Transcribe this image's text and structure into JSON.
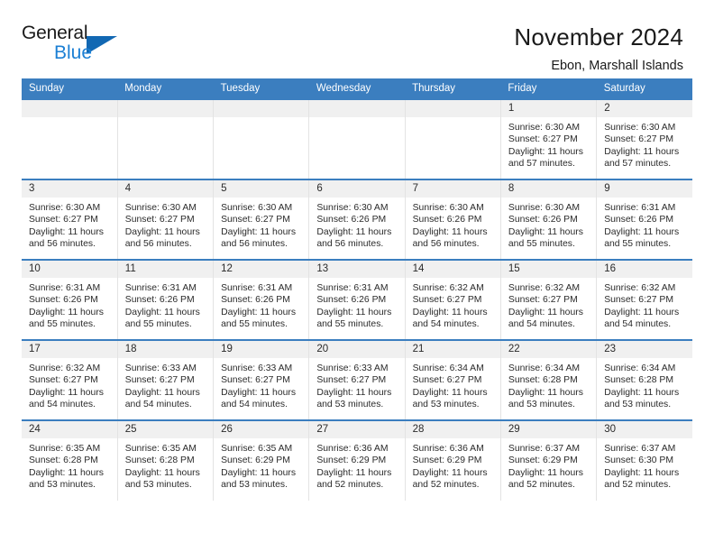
{
  "logo": {
    "word1": "General",
    "word2": "Blue",
    "triangle": "blue-triangle",
    "accent_color": "#1268b3",
    "blue_text_color": "#1b7fd4"
  },
  "header": {
    "title": "November 2024",
    "subtitle": "Ebon, Marshall Islands"
  },
  "calendar": {
    "header_bg": "#3b7ebf",
    "daynum_bg": "#f0f0f0",
    "weekdays": [
      "Sunday",
      "Monday",
      "Tuesday",
      "Wednesday",
      "Thursday",
      "Friday",
      "Saturday"
    ],
    "weeks": [
      [
        {
          "day": "",
          "empty": true
        },
        {
          "day": "",
          "empty": true
        },
        {
          "day": "",
          "empty": true
        },
        {
          "day": "",
          "empty": true
        },
        {
          "day": "",
          "empty": true
        },
        {
          "day": "1",
          "sunrise": "Sunrise: 6:30 AM",
          "sunset": "Sunset: 6:27 PM",
          "daylight": "Daylight: 11 hours and 57 minutes."
        },
        {
          "day": "2",
          "sunrise": "Sunrise: 6:30 AM",
          "sunset": "Sunset: 6:27 PM",
          "daylight": "Daylight: 11 hours and 57 minutes."
        }
      ],
      [
        {
          "day": "3",
          "sunrise": "Sunrise: 6:30 AM",
          "sunset": "Sunset: 6:27 PM",
          "daylight": "Daylight: 11 hours and 56 minutes."
        },
        {
          "day": "4",
          "sunrise": "Sunrise: 6:30 AM",
          "sunset": "Sunset: 6:27 PM",
          "daylight": "Daylight: 11 hours and 56 minutes."
        },
        {
          "day": "5",
          "sunrise": "Sunrise: 6:30 AM",
          "sunset": "Sunset: 6:27 PM",
          "daylight": "Daylight: 11 hours and 56 minutes."
        },
        {
          "day": "6",
          "sunrise": "Sunrise: 6:30 AM",
          "sunset": "Sunset: 6:26 PM",
          "daylight": "Daylight: 11 hours and 56 minutes."
        },
        {
          "day": "7",
          "sunrise": "Sunrise: 6:30 AM",
          "sunset": "Sunset: 6:26 PM",
          "daylight": "Daylight: 11 hours and 56 minutes."
        },
        {
          "day": "8",
          "sunrise": "Sunrise: 6:30 AM",
          "sunset": "Sunset: 6:26 PM",
          "daylight": "Daylight: 11 hours and 55 minutes."
        },
        {
          "day": "9",
          "sunrise": "Sunrise: 6:31 AM",
          "sunset": "Sunset: 6:26 PM",
          "daylight": "Daylight: 11 hours and 55 minutes."
        }
      ],
      [
        {
          "day": "10",
          "sunrise": "Sunrise: 6:31 AM",
          "sunset": "Sunset: 6:26 PM",
          "daylight": "Daylight: 11 hours and 55 minutes."
        },
        {
          "day": "11",
          "sunrise": "Sunrise: 6:31 AM",
          "sunset": "Sunset: 6:26 PM",
          "daylight": "Daylight: 11 hours and 55 minutes."
        },
        {
          "day": "12",
          "sunrise": "Sunrise: 6:31 AM",
          "sunset": "Sunset: 6:26 PM",
          "daylight": "Daylight: 11 hours and 55 minutes."
        },
        {
          "day": "13",
          "sunrise": "Sunrise: 6:31 AM",
          "sunset": "Sunset: 6:26 PM",
          "daylight": "Daylight: 11 hours and 55 minutes."
        },
        {
          "day": "14",
          "sunrise": "Sunrise: 6:32 AM",
          "sunset": "Sunset: 6:27 PM",
          "daylight": "Daylight: 11 hours and 54 minutes."
        },
        {
          "day": "15",
          "sunrise": "Sunrise: 6:32 AM",
          "sunset": "Sunset: 6:27 PM",
          "daylight": "Daylight: 11 hours and 54 minutes."
        },
        {
          "day": "16",
          "sunrise": "Sunrise: 6:32 AM",
          "sunset": "Sunset: 6:27 PM",
          "daylight": "Daylight: 11 hours and 54 minutes."
        }
      ],
      [
        {
          "day": "17",
          "sunrise": "Sunrise: 6:32 AM",
          "sunset": "Sunset: 6:27 PM",
          "daylight": "Daylight: 11 hours and 54 minutes."
        },
        {
          "day": "18",
          "sunrise": "Sunrise: 6:33 AM",
          "sunset": "Sunset: 6:27 PM",
          "daylight": "Daylight: 11 hours and 54 minutes."
        },
        {
          "day": "19",
          "sunrise": "Sunrise: 6:33 AM",
          "sunset": "Sunset: 6:27 PM",
          "daylight": "Daylight: 11 hours and 54 minutes."
        },
        {
          "day": "20",
          "sunrise": "Sunrise: 6:33 AM",
          "sunset": "Sunset: 6:27 PM",
          "daylight": "Daylight: 11 hours and 53 minutes."
        },
        {
          "day": "21",
          "sunrise": "Sunrise: 6:34 AM",
          "sunset": "Sunset: 6:27 PM",
          "daylight": "Daylight: 11 hours and 53 minutes."
        },
        {
          "day": "22",
          "sunrise": "Sunrise: 6:34 AM",
          "sunset": "Sunset: 6:28 PM",
          "daylight": "Daylight: 11 hours and 53 minutes."
        },
        {
          "day": "23",
          "sunrise": "Sunrise: 6:34 AM",
          "sunset": "Sunset: 6:28 PM",
          "daylight": "Daylight: 11 hours and 53 minutes."
        }
      ],
      [
        {
          "day": "24",
          "sunrise": "Sunrise: 6:35 AM",
          "sunset": "Sunset: 6:28 PM",
          "daylight": "Daylight: 11 hours and 53 minutes."
        },
        {
          "day": "25",
          "sunrise": "Sunrise: 6:35 AM",
          "sunset": "Sunset: 6:28 PM",
          "daylight": "Daylight: 11 hours and 53 minutes."
        },
        {
          "day": "26",
          "sunrise": "Sunrise: 6:35 AM",
          "sunset": "Sunset: 6:29 PM",
          "daylight": "Daylight: 11 hours and 53 minutes."
        },
        {
          "day": "27",
          "sunrise": "Sunrise: 6:36 AM",
          "sunset": "Sunset: 6:29 PM",
          "daylight": "Daylight: 11 hours and 52 minutes."
        },
        {
          "day": "28",
          "sunrise": "Sunrise: 6:36 AM",
          "sunset": "Sunset: 6:29 PM",
          "daylight": "Daylight: 11 hours and 52 minutes."
        },
        {
          "day": "29",
          "sunrise": "Sunrise: 6:37 AM",
          "sunset": "Sunset: 6:29 PM",
          "daylight": "Daylight: 11 hours and 52 minutes."
        },
        {
          "day": "30",
          "sunrise": "Sunrise: 6:37 AM",
          "sunset": "Sunset: 6:30 PM",
          "daylight": "Daylight: 11 hours and 52 minutes."
        }
      ]
    ]
  }
}
